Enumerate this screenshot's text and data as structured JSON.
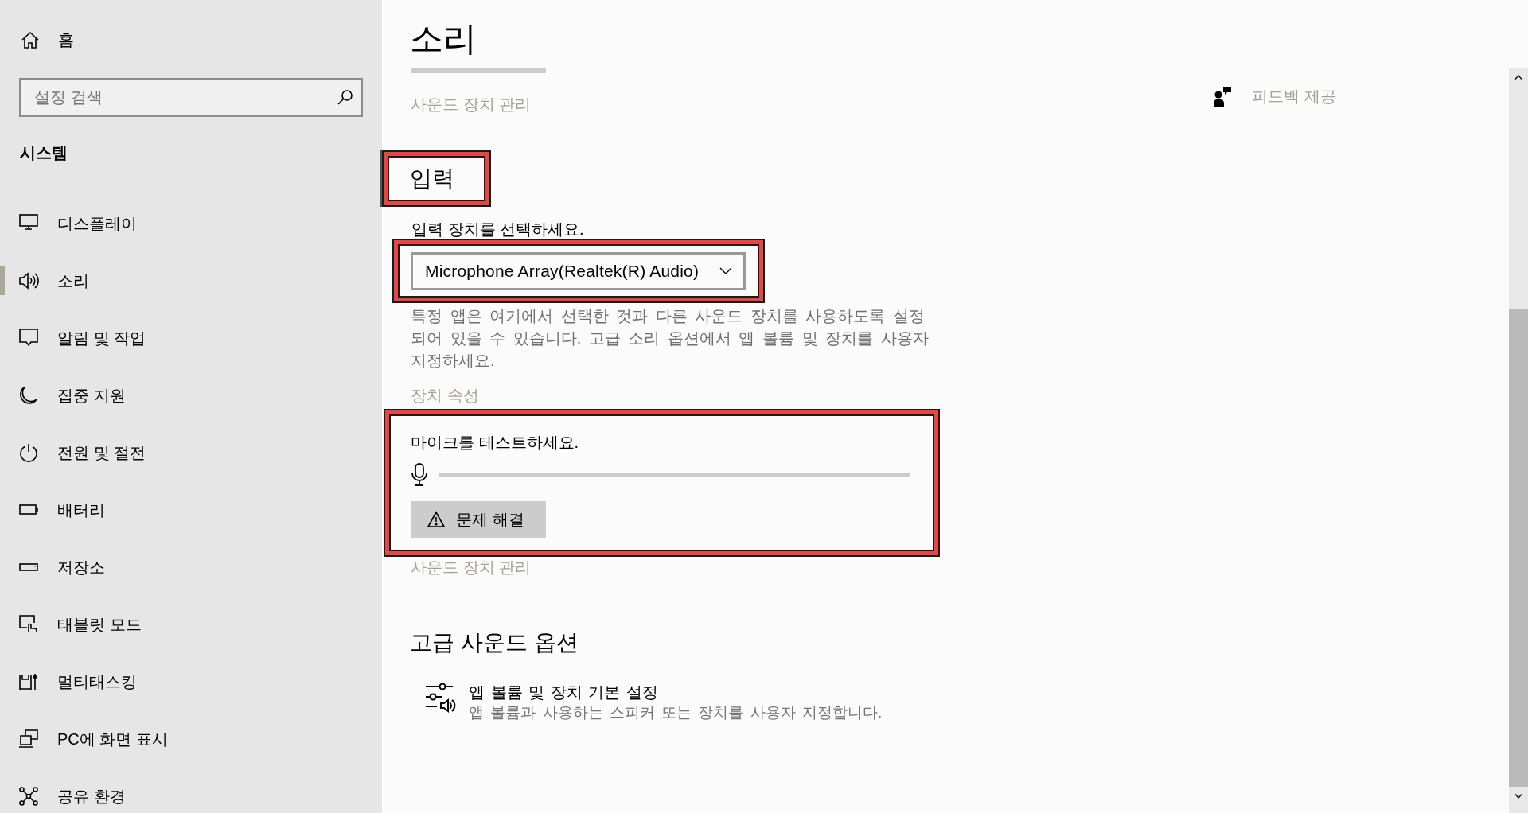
{
  "sidebar": {
    "home": "홈",
    "search": {
      "placeholder": "설정 검색"
    },
    "section": "시스템",
    "items": [
      {
        "label": "디스플레이",
        "selected": false
      },
      {
        "label": "소리",
        "selected": true
      },
      {
        "label": "알림 및 작업",
        "selected": false
      },
      {
        "label": "집중 지원",
        "selected": false
      },
      {
        "label": "전원 및 절전",
        "selected": false
      },
      {
        "label": "배터리",
        "selected": false
      },
      {
        "label": "저장소",
        "selected": false
      },
      {
        "label": "태블릿 모드",
        "selected": false
      },
      {
        "label": "멀티태스킹",
        "selected": false
      },
      {
        "label": "PC에 화면 표시",
        "selected": false
      },
      {
        "label": "공유 환경",
        "selected": false
      }
    ]
  },
  "header": {
    "title": "소리",
    "manage_link": "사운드 장치 관리"
  },
  "feedback": {
    "label": "피드백 제공"
  },
  "input": {
    "heading": "입력",
    "highlighted": true,
    "device_prompt": "입력 장치를 선택하세요.",
    "device_select": {
      "value": "Microphone Array(Realtek(R) Audio)",
      "highlighted": true
    },
    "description": "특정 앱은 여기에서 선택한 것과 다른 사운드 장치를 사용하도록 설정 되어 있을 수 있습니다. 고급 소리 옵션에서 앱 볼륨 및 장치를 사용자 지정하세요.",
    "properties_link": "장치 속성",
    "mic_test": {
      "label": "마이크를 테스트하세요.",
      "highlighted": true,
      "troubleshoot_button": "문제 해결"
    },
    "manage_link": "사운드 장치 관리"
  },
  "advanced": {
    "heading": "고급 사운드 옵션",
    "items": [
      {
        "title": "앱 볼륨 및 장치 기본 설정",
        "description": "앱 볼륨과 사용하는 스피커 또는 장치를 사용자 지정합니다."
      }
    ]
  }
}
